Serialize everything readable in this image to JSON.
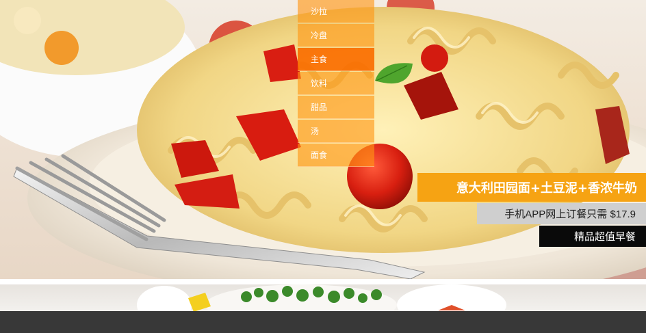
{
  "menu": {
    "items": [
      {
        "label": "沙拉"
      },
      {
        "label": "冷盘"
      },
      {
        "label": "主食"
      },
      {
        "label": "饮料"
      },
      {
        "label": "甜品"
      },
      {
        "label": "汤"
      },
      {
        "label": "面食"
      }
    ],
    "active_label": "主食"
  },
  "promo": {
    "title": "意大利田园面+土豆泥+香浓牛奶",
    "price_text": "手机APP网上订餐只需 $17.9",
    "tag": "精品超值早餐"
  },
  "colors": {
    "menu_bg": "#ff9614",
    "menu_active": "#fa6e00",
    "title_bg": "#f6a313",
    "price_bg": "#cfcfcf",
    "tag_bg": "#0a0a0a",
    "footer_bg": "#383838"
  }
}
